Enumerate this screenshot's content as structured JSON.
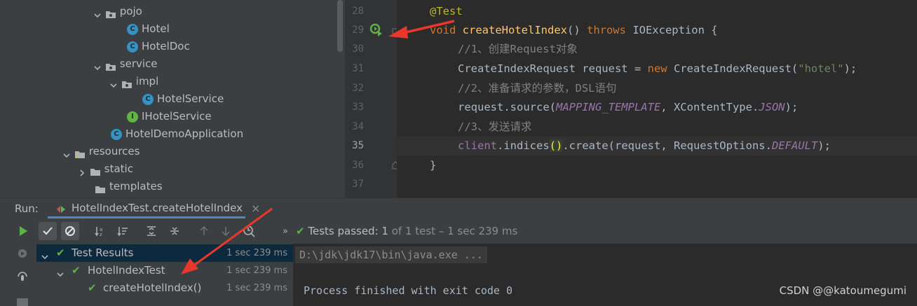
{
  "tree": {
    "items": [
      {
        "label": "pojo",
        "kind": "package",
        "expanded": true
      },
      {
        "label": "Hotel",
        "kind": "class"
      },
      {
        "label": "HotelDoc",
        "kind": "class"
      },
      {
        "label": "service",
        "kind": "package",
        "expanded": true
      },
      {
        "label": "impl",
        "kind": "package",
        "expanded": true
      },
      {
        "label": "HotelService",
        "kind": "class"
      },
      {
        "label": "IHotelService",
        "kind": "interface"
      },
      {
        "label": "HotelDemoApplication",
        "kind": "spring-class"
      },
      {
        "label": "resources",
        "kind": "resource-folder",
        "expanded": true
      },
      {
        "label": "static",
        "kind": "folder",
        "expanded": false
      },
      {
        "label": "templates",
        "kind": "folder"
      }
    ]
  },
  "editor": {
    "line_numbers": [
      "28",
      "29",
      "30",
      "31",
      "32",
      "33",
      "34",
      "35",
      "36",
      "37"
    ],
    "current_line": "35",
    "code": {
      "l28_annotation": "@Test",
      "l29_void": "void ",
      "l29_method": "createHotelIndex",
      "l29_parens": "() ",
      "l29_throws": "throws",
      "l29_rest": " IOException {",
      "l30_comment": "//1、创建Request对象",
      "l31_a": "CreateIndexRequest request = ",
      "l31_new": "new",
      "l31_b": " CreateIndexRequest(",
      "l31_str": "\"hotel\"",
      "l31_c": ");",
      "l32_comment": "//2、准备请求的参数，DSL语句",
      "l33_a": "request.source(",
      "l33_const": "MAPPING_TEMPLATE",
      "l33_b": ", XContentType.",
      "l33_json": "JSON",
      "l33_c": ");",
      "l34_comment": "//3、发送请求",
      "l35_field": "client",
      "l35_a": ".indices",
      "l35_paren_open": "(",
      "l35_paren_close": ")",
      "l35_b": ".create(request, RequestOptions.",
      "l35_default": "DEFAULT",
      "l35_c": ");",
      "l36_brace": "}"
    }
  },
  "run": {
    "label": "Run:",
    "tab_title": "HotelIndexTest.createHotelIndex",
    "status_prefix": "Tests passed: ",
    "status_count": "1",
    "status_suffix": " of 1 test – 1 sec 239 ms",
    "results": [
      {
        "label": "Test Results",
        "time": "1 sec 239 ms"
      },
      {
        "label": "HotelIndexTest",
        "time": "1 sec 239 ms"
      },
      {
        "label": "createHotelIndex()",
        "time": "1 sec 239 ms"
      }
    ],
    "console": {
      "command": "D:\\jdk\\jdk17\\bin\\java.exe ...",
      "exit": "Process finished with exit code 0"
    }
  },
  "watermark": "CSDN @@katoumegumi",
  "colors": {
    "accent_arrow": "#e8372b",
    "pass_green": "#5fb148",
    "class_blue": "#3592c4"
  }
}
